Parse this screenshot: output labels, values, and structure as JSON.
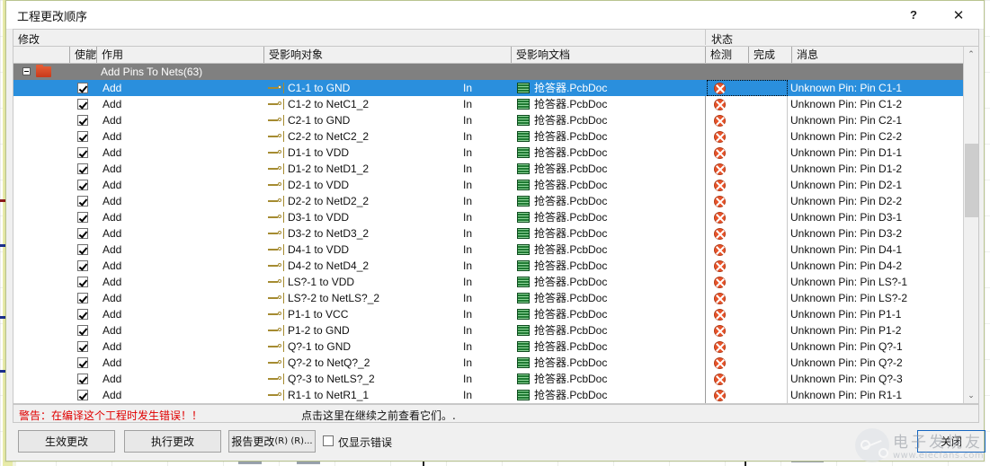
{
  "window": {
    "title": "工程更改顺序",
    "help_label": "?",
    "close_label": "✕"
  },
  "modify_bar": {
    "modify_label": "修改",
    "state_label": "状态"
  },
  "grid": {
    "headers": {
      "enable": "使能",
      "action": "作用",
      "affected_object": "受影响对象",
      "affected_document": "受影响文档",
      "check": "检测",
      "done": "完成",
      "message": "消息"
    },
    "group": {
      "label": "Add Pins To Nets(63)",
      "expander": "−"
    },
    "rows": [
      {
        "enabled": true,
        "action": "Add",
        "object": "C1-1 to GND",
        "direction": "In",
        "document": "抢答器.PcbDoc",
        "message": "Unknown Pin: Pin C1-1",
        "selected": true
      },
      {
        "enabled": true,
        "action": "Add",
        "object": "C1-2 to NetC1_2",
        "direction": "In",
        "document": "抢答器.PcbDoc",
        "message": "Unknown Pin: Pin C1-2",
        "selected": false
      },
      {
        "enabled": true,
        "action": "Add",
        "object": "C2-1 to GND",
        "direction": "In",
        "document": "抢答器.PcbDoc",
        "message": "Unknown Pin: Pin C2-1",
        "selected": false
      },
      {
        "enabled": true,
        "action": "Add",
        "object": "C2-2 to NetC2_2",
        "direction": "In",
        "document": "抢答器.PcbDoc",
        "message": "Unknown Pin: Pin C2-2",
        "selected": false
      },
      {
        "enabled": true,
        "action": "Add",
        "object": "D1-1 to VDD",
        "direction": "In",
        "document": "抢答器.PcbDoc",
        "message": "Unknown Pin: Pin D1-1",
        "selected": false
      },
      {
        "enabled": true,
        "action": "Add",
        "object": "D1-2 to NetD1_2",
        "direction": "In",
        "document": "抢答器.PcbDoc",
        "message": "Unknown Pin: Pin D1-2",
        "selected": false
      },
      {
        "enabled": true,
        "action": "Add",
        "object": "D2-1 to VDD",
        "direction": "In",
        "document": "抢答器.PcbDoc",
        "message": "Unknown Pin: Pin D2-1",
        "selected": false
      },
      {
        "enabled": true,
        "action": "Add",
        "object": "D2-2 to NetD2_2",
        "direction": "In",
        "document": "抢答器.PcbDoc",
        "message": "Unknown Pin: Pin D2-2",
        "selected": false
      },
      {
        "enabled": true,
        "action": "Add",
        "object": "D3-1 to VDD",
        "direction": "In",
        "document": "抢答器.PcbDoc",
        "message": "Unknown Pin: Pin D3-1",
        "selected": false
      },
      {
        "enabled": true,
        "action": "Add",
        "object": "D3-2 to NetD3_2",
        "direction": "In",
        "document": "抢答器.PcbDoc",
        "message": "Unknown Pin: Pin D3-2",
        "selected": false
      },
      {
        "enabled": true,
        "action": "Add",
        "object": "D4-1 to VDD",
        "direction": "In",
        "document": "抢答器.PcbDoc",
        "message": "Unknown Pin: Pin D4-1",
        "selected": false
      },
      {
        "enabled": true,
        "action": "Add",
        "object": "D4-2 to NetD4_2",
        "direction": "In",
        "document": "抢答器.PcbDoc",
        "message": "Unknown Pin: Pin D4-2",
        "selected": false
      },
      {
        "enabled": true,
        "action": "Add",
        "object": "LS?-1 to VDD",
        "direction": "In",
        "document": "抢答器.PcbDoc",
        "message": "Unknown Pin: Pin LS?-1",
        "selected": false
      },
      {
        "enabled": true,
        "action": "Add",
        "object": "LS?-2 to NetLS?_2",
        "direction": "In",
        "document": "抢答器.PcbDoc",
        "message": "Unknown Pin: Pin LS?-2",
        "selected": false
      },
      {
        "enabled": true,
        "action": "Add",
        "object": "P1-1 to VCC",
        "direction": "In",
        "document": "抢答器.PcbDoc",
        "message": "Unknown Pin: Pin P1-1",
        "selected": false
      },
      {
        "enabled": true,
        "action": "Add",
        "object": "P1-2 to GND",
        "direction": "In",
        "document": "抢答器.PcbDoc",
        "message": "Unknown Pin: Pin P1-2",
        "selected": false
      },
      {
        "enabled": true,
        "action": "Add",
        "object": "Q?-1 to GND",
        "direction": "In",
        "document": "抢答器.PcbDoc",
        "message": "Unknown Pin: Pin Q?-1",
        "selected": false
      },
      {
        "enabled": true,
        "action": "Add",
        "object": "Q?-2 to NetQ?_2",
        "direction": "In",
        "document": "抢答器.PcbDoc",
        "message": "Unknown Pin: Pin Q?-2",
        "selected": false
      },
      {
        "enabled": true,
        "action": "Add",
        "object": "Q?-3 to NetLS?_2",
        "direction": "In",
        "document": "抢答器.PcbDoc",
        "message": "Unknown Pin: Pin Q?-3",
        "selected": false
      },
      {
        "enabled": true,
        "action": "Add",
        "object": "R1-1 to NetR1_1",
        "direction": "In",
        "document": "抢答器.PcbDoc",
        "message": "Unknown Pin: Pin R1-1",
        "selected": false
      }
    ]
  },
  "warning": {
    "text": "警告：在编译这个工程时发生错误！！",
    "hint": "点击这里在继续之前查看它们。."
  },
  "buttons": {
    "validate": "生效更改",
    "execute": "执行更改",
    "report_main": "报告更改",
    "report_mnemonic": "(R) (R)...",
    "only_errors_label": "仅显示错误",
    "only_errors_checked": false,
    "close": "关闭"
  },
  "scrollbar": {
    "up_arrow": "⌃",
    "down_arrow": "⌄"
  },
  "watermark": {
    "text": "电子发烧友",
    "url": "www.elecfans.com"
  },
  "colors": {
    "selection": "#2a8fdd",
    "group_row": "#808080",
    "error_icon": "#e8532a",
    "warning_text": "#e00000",
    "dialog_border": "#b9c48f"
  }
}
